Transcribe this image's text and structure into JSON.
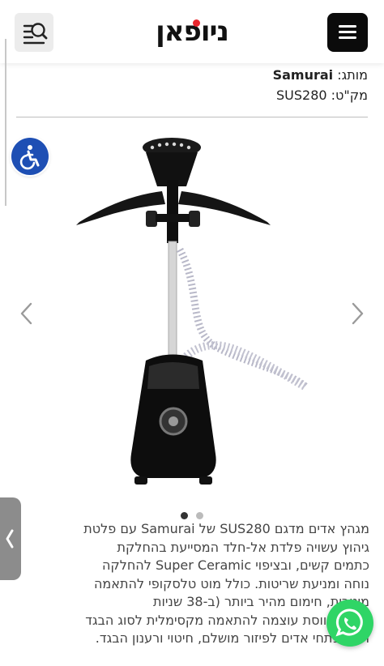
{
  "header": {
    "logo_text": "ניופאן",
    "search_icon": "search-list-icon",
    "menu_icon": "hamburger-menu-icon"
  },
  "product": {
    "brand_label": "מותג:",
    "brand_value": "Samurai",
    "sku_label": "מק\"ט:",
    "sku_value": "SUS280",
    "image_alt": "Samurai SUS280 garment steamer",
    "carousel": {
      "slides": 2,
      "active": 1
    }
  },
  "description": {
    "lines": [
      "מגהץ אדים מדגם SUS280 של Samurai עם פלטת",
      "גיהוץ עשויה פלדת אל-חלד המסייעת בהחלקת",
      "כתמים קשים, ובציפוי Super Ceramic להחלקה",
      "נוחה ומניעת שריטות. כולל מוט טלסקופי להתאמה",
      "מיטבית, חימום מהיר ביותר (ב-38 שניות",
      "בלבד), ווסת עוצמה להתאמה מקסימלית לסוג הבגד",
      "ו-10 פתחי אדים לפיזור מושלם, חיטוי ורענון הבגד."
    ]
  },
  "colors": {
    "accessibility": "#1e4fb4",
    "whatsapp": "#2fd566",
    "brand_red": "#e8262d",
    "dot_active": "#333333",
    "dot_inactive": "#bbbbbb"
  }
}
